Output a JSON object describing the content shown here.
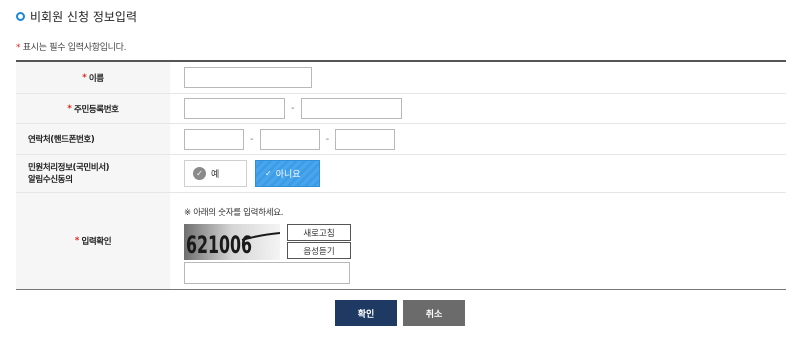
{
  "header": {
    "title": "비회원 신청 정보입력"
  },
  "required_note": {
    "star": "*",
    "text": " 표시는 필수 입력사항입니다."
  },
  "fields": {
    "name": {
      "star": "*",
      "label": "이름",
      "value": ""
    },
    "rrn": {
      "star": "*",
      "label": "주민등록번호",
      "part1": "",
      "part2": "",
      "dash": "-"
    },
    "phone": {
      "label": "연락처(핸드폰번호)",
      "part1": "",
      "part2": "",
      "part3": "",
      "dash": "-"
    },
    "consent": {
      "label_line1": "민원처리정보(국민비서)",
      "label_line2": "알림수신동의",
      "yes_label": "예",
      "no_label": "아니요",
      "selected": "아니요"
    },
    "captcha": {
      "star": "*",
      "label": "입력확인",
      "note": "※ 아래의 숫자를 입력하세요.",
      "image_text": "621006",
      "refresh_label": "새로고침",
      "audio_label": "음성듣기",
      "value": ""
    }
  },
  "buttons": {
    "confirm": "확인",
    "cancel": "취소"
  },
  "colors": {
    "accent": "#1a88d8",
    "required": "#e2231a",
    "confirm_bg": "#1f3a62",
    "cancel_bg": "#6b6b6b",
    "selected_bg": "#4aa6ec"
  }
}
